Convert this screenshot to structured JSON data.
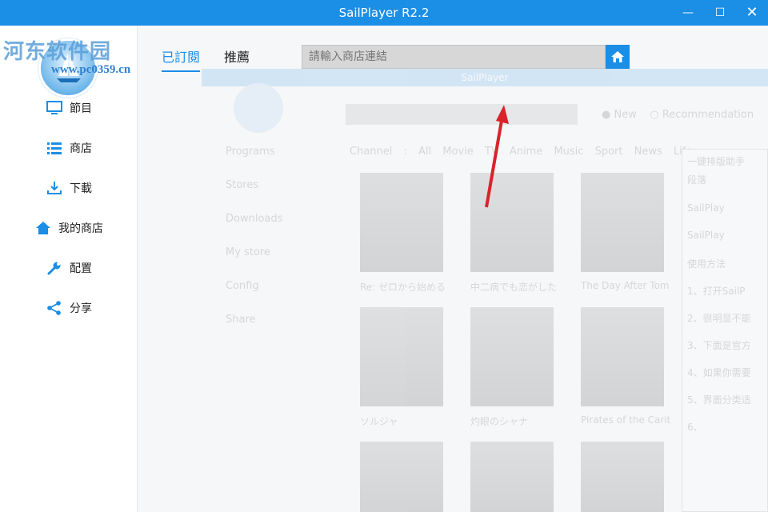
{
  "window": {
    "title": "SailPlayer  R2.2",
    "controls": {
      "minimize": "—",
      "maximize": "☐",
      "close": "✕"
    }
  },
  "watermark": {
    "text": "河东软件园",
    "url": "www.pc0359.cn"
  },
  "sidebar": {
    "items": [
      {
        "label": "節目",
        "icon": "monitor-icon"
      },
      {
        "label": "商店",
        "icon": "list-icon"
      },
      {
        "label": "下載",
        "icon": "download-icon"
      },
      {
        "label": "我的商店",
        "icon": "home-icon"
      },
      {
        "label": "配置",
        "icon": "wrench-icon"
      },
      {
        "label": "分享",
        "icon": "share-icon"
      }
    ]
  },
  "main": {
    "tabs": [
      {
        "label": "已訂閱",
        "active": true
      },
      {
        "label": "推薦",
        "active": false
      }
    ],
    "search": {
      "placeholder": "請輸入商店連結",
      "value": ""
    },
    "home_button_icon": "home-icon"
  },
  "ghost_overlay": {
    "title": "SailPlayer",
    "nav": [
      "Programs",
      "Stores",
      "Downloads",
      "My store",
      "Config",
      "Share"
    ],
    "radio": [
      "New",
      "Recommendation"
    ],
    "channels_label": "Channel :",
    "channels": [
      "All",
      "Movie",
      "TV",
      "Anime",
      "Music",
      "Sport",
      "News",
      "Life"
    ],
    "posters": [
      {
        "caption": "Re: ゼロから始める"
      },
      {
        "caption": "中二病でも恋がした"
      },
      {
        "caption": "The Day After Tom"
      },
      {
        "caption": "ソルジャ"
      },
      {
        "caption": "灼眼のシャナ"
      },
      {
        "caption": "Pirates of the Carit"
      }
    ],
    "panel": {
      "title": "一键排版助手",
      "style": "段落",
      "lines": [
        "SailPlay",
        "SailPlay",
        "使用方法",
        "1、打开SailP",
        "2、很明显不能",
        "3、下面是官方",
        "4、如果你需要",
        "5、界面分类适",
        "6、"
      ]
    }
  },
  "colors": {
    "accent": "#1b8ee6",
    "arrow": "#d9232a"
  }
}
